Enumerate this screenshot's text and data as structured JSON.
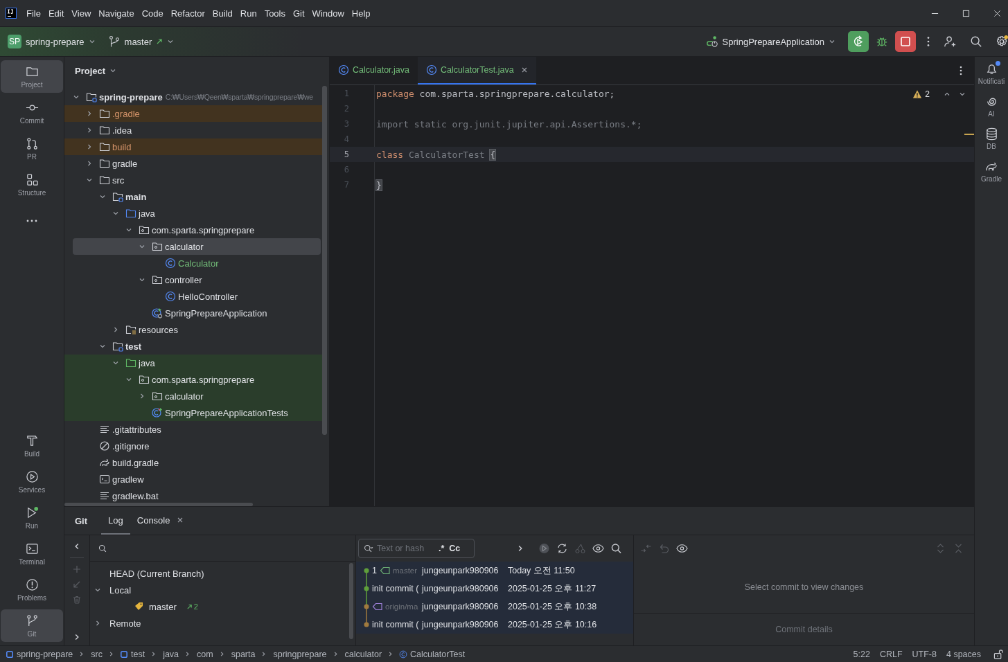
{
  "window": {
    "menu": [
      "File",
      "Edit",
      "View",
      "Navigate",
      "Code",
      "Refactor",
      "Build",
      "Run",
      "Tools",
      "Git",
      "Window",
      "Help"
    ]
  },
  "toolbar": {
    "project_badge": "SP",
    "project": "spring-prepare",
    "branch": "master",
    "run_config": "SpringPrepareApplication",
    "settings_badge": true
  },
  "left_stripe": {
    "top": [
      {
        "label": "Project",
        "kind": "folder",
        "selected": true
      },
      {
        "label": "Commit",
        "kind": "commit",
        "selected": false
      },
      {
        "label": "PR",
        "kind": "pull-request",
        "selected": false
      },
      {
        "label": "Structure",
        "kind": "structure",
        "selected": false
      },
      {
        "kind": "more",
        "selected": false
      }
    ],
    "bottom": [
      {
        "label": "Build",
        "kind": "hammer",
        "selected": false
      },
      {
        "label": "Services",
        "kind": "services",
        "selected": false
      },
      {
        "label": "Run",
        "kind": "run",
        "selected": false
      },
      {
        "label": "Terminal",
        "kind": "terminal",
        "selected": false
      },
      {
        "label": "Problems",
        "kind": "problems",
        "selected": false
      },
      {
        "label": "Git",
        "kind": "git",
        "selected": true
      }
    ]
  },
  "project": {
    "title": "Project",
    "tree": [
      {
        "label": "spring-prepare",
        "path": "C:₩Users₩Qeen₩sparta₩springprepare₩we",
        "kind": "module",
        "expanded": true,
        "selected": false,
        "excluded": false,
        "test_source": false,
        "added": false,
        "children": [
          {
            "label": ".gradle",
            "kind": "folder",
            "expanded": false,
            "selected": false,
            "excluded": true,
            "test_source": false,
            "added": false
          },
          {
            "label": ".idea",
            "kind": "folder",
            "expanded": false,
            "selected": false,
            "excluded": false,
            "test_source": false,
            "added": false
          },
          {
            "label": "build",
            "kind": "folder",
            "expanded": false,
            "selected": false,
            "excluded": true,
            "test_source": false,
            "added": false
          },
          {
            "label": "gradle",
            "kind": "folder",
            "expanded": false,
            "selected": false,
            "excluded": false,
            "test_source": false,
            "added": false
          },
          {
            "label": "src",
            "kind": "folder",
            "expanded": true,
            "selected": false,
            "excluded": false,
            "test_source": false,
            "added": false,
            "children": [
              {
                "label": "main",
                "kind": "module",
                "expanded": true,
                "selected": false,
                "excluded": false,
                "test_source": false,
                "added": false,
                "children": [
                  {
                    "label": "java",
                    "kind": "source-folder",
                    "expanded": true,
                    "selected": false,
                    "excluded": false,
                    "test_source": false,
                    "added": false,
                    "children": [
                      {
                        "label": "com.sparta.springprepare",
                        "kind": "package",
                        "expanded": true,
                        "selected": false,
                        "excluded": false,
                        "test_source": false,
                        "added": false,
                        "children": [
                          {
                            "label": "calculator",
                            "kind": "package",
                            "expanded": true,
                            "selected": true,
                            "excluded": false,
                            "test_source": false,
                            "added": false,
                            "children": [
                              {
                                "label": "Calculator",
                                "kind": "class",
                                "selected": false,
                                "excluded": false,
                                "test_source": false,
                                "added": true
                              }
                            ]
                          },
                          {
                            "label": "controller",
                            "kind": "package",
                            "expanded": true,
                            "selected": false,
                            "excluded": false,
                            "test_source": false,
                            "added": false,
                            "children": [
                              {
                                "label": "HelloController",
                                "kind": "class",
                                "selected": false,
                                "excluded": false,
                                "test_source": false,
                                "added": false
                              }
                            ]
                          },
                          {
                            "label": "SpringPrepareApplication",
                            "kind": "spring-app",
                            "selected": false,
                            "excluded": false,
                            "test_source": false,
                            "added": false
                          }
                        ]
                      }
                    ]
                  },
                  {
                    "label": "resources",
                    "kind": "resources",
                    "expanded": false,
                    "selected": false,
                    "excluded": false,
                    "test_source": false,
                    "added": false
                  }
                ]
              },
              {
                "label": "test",
                "kind": "module",
                "expanded": true,
                "selected": false,
                "excluded": false,
                "test_source": false,
                "added": false,
                "children": [
                  {
                    "label": "java",
                    "kind": "test-folder",
                    "expanded": true,
                    "selected": false,
                    "excluded": false,
                    "test_source": true,
                    "added": false,
                    "children": [
                      {
                        "label": "com.sparta.springprepare",
                        "kind": "package",
                        "expanded": true,
                        "selected": false,
                        "excluded": false,
                        "test_source": true,
                        "added": false,
                        "children": [
                          {
                            "label": "calculator",
                            "kind": "package",
                            "expanded": false,
                            "selected": false,
                            "excluded": false,
                            "test_source": true,
                            "added": false
                          },
                          {
                            "label": "SpringPrepareApplicationTests",
                            "kind": "test-class",
                            "selected": false,
                            "excluded": false,
                            "test_source": true,
                            "added": false
                          }
                        ]
                      }
                    ]
                  }
                ]
              }
            ]
          },
          {
            "label": ".gitattributes",
            "kind": "text-file",
            "selected": false,
            "excluded": false,
            "test_source": false,
            "added": false
          },
          {
            "label": ".gitignore",
            "kind": "ignore",
            "selected": false,
            "excluded": false,
            "test_source": false,
            "added": false
          },
          {
            "label": "build.gradle",
            "kind": "gradle",
            "selected": false,
            "excluded": false,
            "test_source": false,
            "added": false
          },
          {
            "label": "gradlew",
            "kind": "terminal-file",
            "selected": false,
            "excluded": false,
            "test_source": false,
            "added": false
          },
          {
            "label": "gradlew.bat",
            "kind": "text-file",
            "selected": false,
            "excluded": false,
            "test_source": false,
            "added": false
          }
        ]
      }
    ]
  },
  "editor": {
    "tabs": [
      {
        "label": "Calculator.java",
        "selected": false,
        "added": true
      },
      {
        "label": "CalculatorTest.java",
        "selected": true,
        "added": true
      }
    ],
    "warnings": "2",
    "lines": [
      {
        "number": "1",
        "current": false,
        "tokens": [
          {
            "kind": "keyword",
            "text": "package"
          },
          {
            "kind": "plain",
            "text": " com.sparta.springprepare.calculator;"
          }
        ]
      },
      {
        "number": "2",
        "current": false
      },
      {
        "number": "3",
        "current": false,
        "tokens": [
          {
            "kind": "unused",
            "text": "import static org.junit.jupiter.api.Assertions.*;"
          }
        ]
      },
      {
        "number": "4",
        "current": false
      },
      {
        "number": "5",
        "current": true,
        "tokens": [
          {
            "kind": "keyword",
            "text": "class"
          },
          {
            "kind": "unused",
            "text": " CalculatorTest "
          },
          {
            "kind": "brace-match",
            "text": "{"
          }
        ]
      },
      {
        "number": "6",
        "current": false
      },
      {
        "number": "7",
        "current": false,
        "tokens": [
          {
            "kind": "brace-match",
            "text": "}"
          }
        ]
      }
    ]
  },
  "right_stripe": [
    {
      "label": "Notificati",
      "kind": "bell",
      "badge": true
    },
    {
      "label": "AI",
      "kind": "spiral",
      "badge": false
    },
    {
      "label": "DB",
      "kind": "database",
      "badge": false
    },
    {
      "label": "Gradle",
      "kind": "gradle",
      "badge": false
    }
  ],
  "git": {
    "title": "Git",
    "tabs": [
      {
        "label": "Log",
        "selected": true,
        "closable": false
      },
      {
        "label": "Console",
        "selected": false,
        "closable": true
      }
    ],
    "branches": [
      {
        "label": "HEAD (Current Branch)"
      },
      {
        "label": "Local",
        "expanded": true,
        "children": [
          {
            "label": "master",
            "ahead": "2"
          }
        ]
      },
      {
        "label": "Remote",
        "expanded": false
      }
    ],
    "filter_placeholder": "Text or hash",
    "regex": ".*",
    "match_case": "Cc",
    "commits": [
      {
        "message": "1",
        "ref": "master",
        "remote": false,
        "author": "jungeunpark980906",
        "date": "Today 오전 11:50",
        "color": "#5f9f3b"
      },
      {
        "message": "init commit (",
        "author": "jungeunpark980906",
        "date": "2025-01-25 오후 11:27",
        "color": "#5f9f3b"
      },
      {
        "ref": "origin/ma",
        "remote": true,
        "author": "jungeunpark980906",
        "date": "2025-01-25 오후 10:38",
        "color": "#a07a3e"
      },
      {
        "message": "init commit (",
        "author": "jungeunpark980906",
        "date": "2025-01-25 오후 10:16",
        "color": "#a07a3e"
      }
    ],
    "changes_hint": "Select commit to view changes",
    "details_hint": "Commit details"
  },
  "status_bar": {
    "breadcrumbs": [
      {
        "label": "spring-prepare",
        "kind": "module-mark"
      },
      {
        "label": "src"
      },
      {
        "label": "test",
        "kind": "module-mark"
      },
      {
        "label": "java"
      },
      {
        "label": "com"
      },
      {
        "label": "sparta"
      },
      {
        "label": "springprepare"
      },
      {
        "label": "calculator"
      },
      {
        "label": "CalculatorTest",
        "kind": "class"
      }
    ],
    "position": "5:22",
    "line_ending": "CRLF",
    "encoding": "UTF-8",
    "indent": "4 spaces"
  }
}
